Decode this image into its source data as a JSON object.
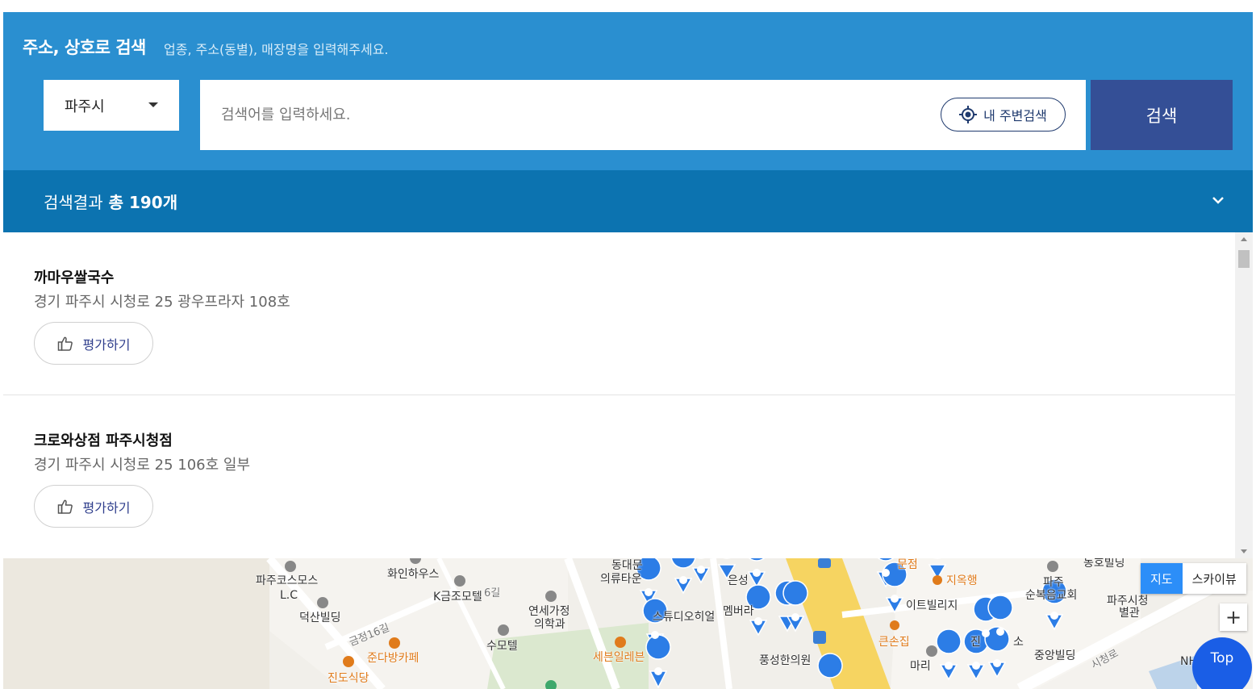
{
  "search": {
    "title": "주소, 상호로 검색",
    "hint": "업종, 주소(동별), 매장명을 입력해주세요.",
    "region": "파주시",
    "placeholder": "검색어를 입력하세요.",
    "nearby_label": "내 주변검색",
    "button_label": "검색"
  },
  "results": {
    "prefix": "검색결과",
    "count_label": "총 190개",
    "items": [
      {
        "name": "까마우쌀국수",
        "address": "경기 파주시 시청로 25 광우프라자 108호",
        "rate_label": "평가하기"
      },
      {
        "name": "크로와상점 파주시청점",
        "address": "경기 파주시 시청로 25 106호 일부",
        "rate_label": "평가하기"
      }
    ]
  },
  "map": {
    "tabs": [
      "지도",
      "스카이뷰"
    ],
    "zoom_in": "+",
    "top_label": "Top",
    "labels": {
      "l1": "파주코스모스",
      "l2": "L.C",
      "l3": "덕산빌딩",
      "l4": "화인하우스",
      "l5": "K금조모텔",
      "l6": "6길",
      "l7": "금정16길",
      "l8": "준다방카페",
      "l9": "진도식당",
      "l10": "연세가정",
      "l11": "의학과",
      "l12": "수모텔",
      "l13": "세븐일레븐",
      "l14": "동대문",
      "l15": "의류타운",
      "l16": "스튜디오히얼",
      "l17": "멤버라",
      "l18": "은성",
      "l19": "풍성한의원",
      "l20": "문점",
      "l21": "지옥행",
      "l22": "이트빌리지",
      "l23": "큰손집",
      "l24": "마리",
      "l25": "파주",
      "l26": "순복음교회",
      "l27": "동호빌딩",
      "l28": "파주시청",
      "l29": "별관",
      "l30": "중앙빌딩",
      "l31": "시청로",
      "l32": "NH",
      "l33": "진",
      "l34": "소"
    }
  },
  "colors": {
    "panel": "#2a8fd0",
    "result_bar": "#0c73b0",
    "search_button": "#344f96",
    "marker": "#2c7de6",
    "top_button": "#1a5ee6"
  }
}
